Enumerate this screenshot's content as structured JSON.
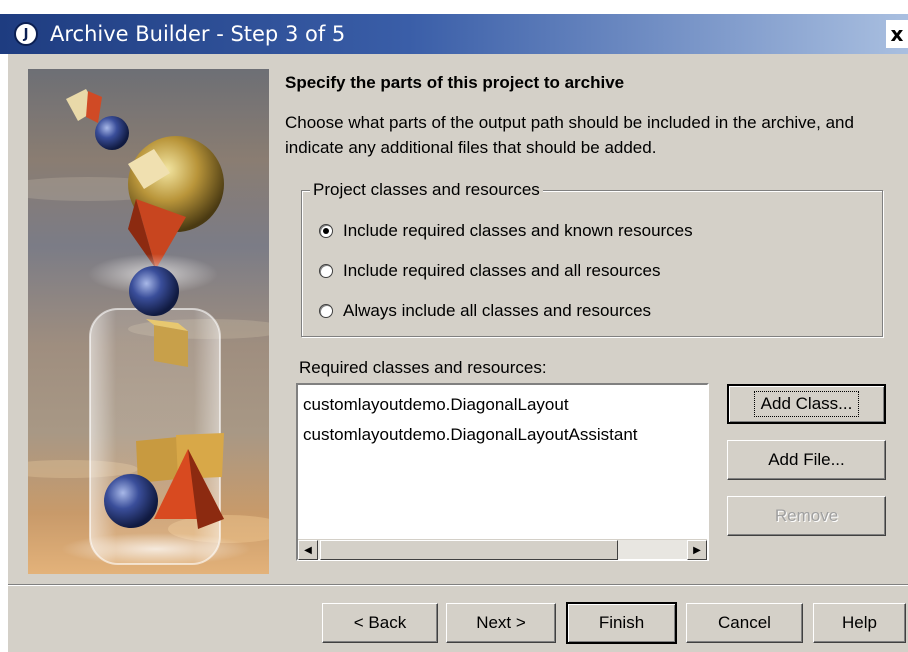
{
  "window": {
    "title": "Archive Builder - Step 3 of 5",
    "logo_letter": "J",
    "close_glyph": "x"
  },
  "page": {
    "heading": "Specify the parts of this project to archive",
    "description": "Choose what parts of the output path should be included in the archive, and indicate any additional files that should be added."
  },
  "group": {
    "title": "Project classes and resources",
    "options": [
      {
        "label": "Include required classes and known resources",
        "selected": true
      },
      {
        "label": "Include required classes and all resources",
        "selected": false
      },
      {
        "label": "Always include all classes and resources",
        "selected": false
      }
    ]
  },
  "required": {
    "label": "Required classes and resources:",
    "items": [
      "customlayoutdemo.DiagonalLayout",
      "customlayoutdemo.DiagonalLayoutAssistant"
    ]
  },
  "side_buttons": {
    "add_class": "Add Class...",
    "add_file": "Add File...",
    "remove": "Remove"
  },
  "footer_buttons": {
    "back": "< Back",
    "next": "Next >",
    "finish": "Finish",
    "cancel": "Cancel",
    "help": "Help"
  },
  "icons": {
    "scroll_left": "◀",
    "scroll_right": "▶"
  },
  "colors": {
    "titlebar_start": "#1e3c80",
    "titlebar_end": "#a9bfe0",
    "dialog_bg": "#d4d0c8"
  }
}
